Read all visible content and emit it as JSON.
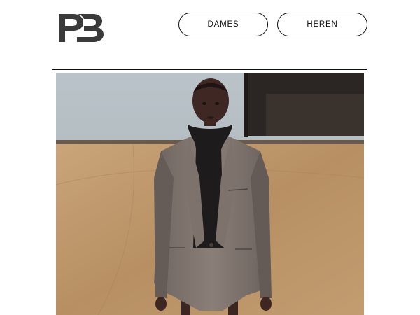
{
  "brand": {
    "logo_icon": "pb-monogram-logo-icon",
    "logo_text": "PB"
  },
  "nav": {
    "women_label": "DAMES",
    "men_label": "HEREN"
  },
  "hero": {
    "image": "model-in-oversized-grey-blazer-image"
  },
  "colors": {
    "text": "#111111",
    "background": "#ffffff",
    "logo": "#3a3a3a"
  }
}
